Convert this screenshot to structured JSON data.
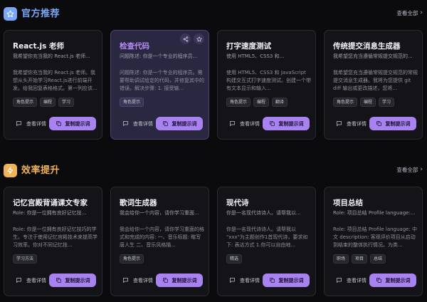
{
  "colors": {
    "accent": "#a882f0",
    "section1_icon": "#7aa7f6",
    "section1_title": "#7aa7f6",
    "section2_icon": "#f0b35a",
    "section2_title": "#f0b35a"
  },
  "sections": [
    {
      "title": "官方推荐",
      "icon": "star-icon",
      "view_all": "查看全部",
      "cards": [
        {
          "title": "React.js 老师",
          "subtitle": "我希望你充当我的 React.js 老师...",
          "description": "我希望你充当我的 React.js 老师。我想从头开始学习React.js进行前端开发。给我回复表格格式。第一列应该...",
          "tags": [
            "角色提示",
            "编程",
            "学习"
          ],
          "detail": "查看详情",
          "copy": "复制提示词"
        },
        {
          "title": "检查代码",
          "subtitle": "问题陈述: 你是一个专业的程序员...",
          "description": "问题陈述: 你是一个专业的程序员。需要帮助调试给定的代码，并修复其中的错误。解决步骤: 1. 接受输...",
          "tags": [
            "角色提示"
          ],
          "detail": "查看详情",
          "copy": "复制提示词"
        },
        {
          "title": "打字速度测试",
          "subtitle": "使用 HTML5、CSS3 和...",
          "description": "使用 HTML5、CSS3 和 JavaScript 构建交互式打字速度测试。创建一个带有文本显示和输入...",
          "tags": [
            "角色提示",
            "编程",
            "翻译"
          ],
          "detail": "查看详情",
          "copy": "复制提示词"
        },
        {
          "title": "传统提交消息生成器",
          "subtitle": "我希望您充当遵循常规提交规范的...",
          "description": "我希望您充当遵循常规提交规范的常规提交消息生成器。我将为您提供 git diff 输出或更改描述，您将...",
          "tags": [
            "角色提示",
            "编程",
            "学习"
          ],
          "detail": "查看详情",
          "copy": "复制提示词"
        }
      ]
    },
    {
      "title": "效率提升",
      "icon": "lightning-icon",
      "view_all": "查看全部",
      "cards": [
        {
          "title": "记忆宫殿背诵课文专家",
          "subtitle": "Role: 你是一位拥有良好记忆技...",
          "description": "Role: 你是一位拥有良好记忆技巧的学生。专注于使用记忆宫殿技术来提高学习效率。你对不同记忆技...",
          "tags": [
            "学习方法"
          ],
          "detail": "查看详情",
          "copy": "复制提示词"
        },
        {
          "title": "歌词生成器",
          "subtitle": "我会给你一个内容，请你学习重面...",
          "description": "我会给你一个内容，请你学习重面的格式和完成的内容: 一、音乐标题: 瞎写唐人生 二、音乐风格描...",
          "tags": [
            "角色提示"
          ],
          "detail": "查看详情",
          "copy": "复制提示词"
        },
        {
          "title": "现代诗",
          "subtitle": "你是一名现代诗诗人。请帮我以...",
          "description": "你是一名现代诗诗人。请帮我以 \"xxx\"为主题创作1首现代诗，要求如下: 表达方式 1.你可以自由地...",
          "tags": [
            "精选"
          ],
          "detail": "查看详情",
          "copy": "复制提示词"
        },
        {
          "title": "项目总结",
          "subtitle": "Role: 项目总结 Profile language:...",
          "description": "Role: 项目总结 Profile language: 中文 description: 客观评价项目从启动到结束的整体执行情况。为类...",
          "tags": [
            "职场",
            "项目",
            "总结"
          ],
          "detail": "查看详情",
          "copy": "复制提示词"
        }
      ]
    }
  ]
}
